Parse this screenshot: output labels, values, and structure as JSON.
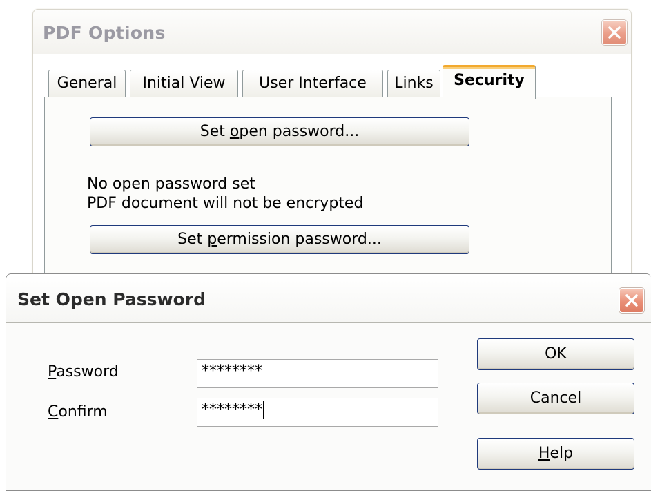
{
  "pdf_options": {
    "title": "PDF Options",
    "tabs": [
      {
        "label": "General",
        "selected": false
      },
      {
        "label": "Initial View",
        "selected": false
      },
      {
        "label": "User Interface",
        "selected": false
      },
      {
        "label": "Links",
        "selected": false
      },
      {
        "label": "Security",
        "selected": true
      }
    ],
    "set_open_password_button": {
      "pre": "Set ",
      "mnemonic": "o",
      "post": "pen password..."
    },
    "status_line_1": "No open password set",
    "status_line_2": "PDF document will not be encrypted",
    "set_permission_password_button": {
      "pre": "Set ",
      "mnemonic": "p",
      "post": "ermission password..."
    }
  },
  "set_open_password": {
    "title": "Set Open Password",
    "password_label": {
      "mnemonic": "P",
      "rest": "assword"
    },
    "password_value": "********",
    "confirm_label": {
      "mnemonic": "C",
      "rest": "onfirm"
    },
    "confirm_value": "********",
    "ok_label": "OK",
    "cancel_label": "Cancel",
    "help_label": {
      "mnemonic": "H",
      "rest": "elp"
    }
  },
  "icons": {
    "close": "close-x-icon"
  },
  "colors": {
    "close_button": "#e98f77",
    "selected_tab_accent": "#f2a92e",
    "button_border": "#1f3a7c"
  }
}
